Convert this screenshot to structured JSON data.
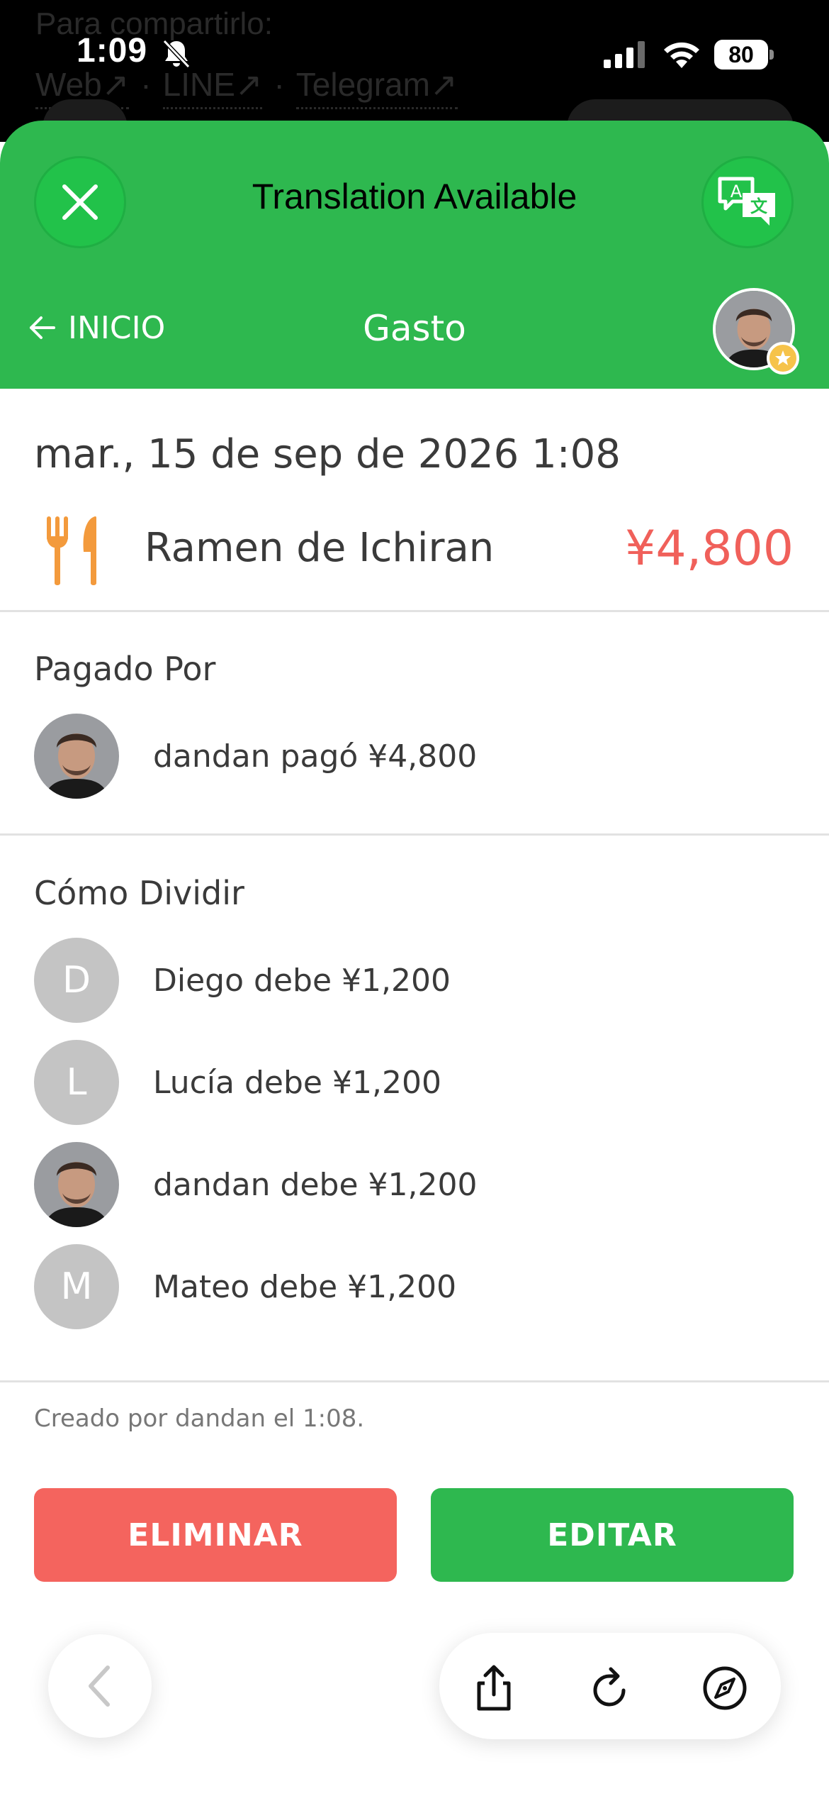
{
  "background_page": {
    "text": "Para compartirlo:",
    "links": [
      "Web↗",
      "LINE↗",
      "Telegram↗"
    ],
    "separator": "·"
  },
  "status_bar": {
    "time": "1:09",
    "battery": "80"
  },
  "banner": {
    "title": "Translation Available"
  },
  "header": {
    "back_label": "INICIO",
    "title": "Gasto"
  },
  "expense": {
    "date": "mar., 15 de sep de 2026 1:08",
    "name": "Ramen de Ichiran",
    "amount": "¥4,800",
    "category_icon": "fork-knife-icon"
  },
  "paid_by": {
    "title": "Pagado Por",
    "rows": [
      {
        "text": "dandan pagó ¥4,800",
        "avatar": "photo"
      }
    ]
  },
  "split": {
    "title": "Cómo Dividir",
    "rows": [
      {
        "initial": "D",
        "text": "Diego debe ¥1,200"
      },
      {
        "initial": "L",
        "text": "Lucía debe ¥1,200"
      },
      {
        "initial": "",
        "text": "dandan debe ¥1,200",
        "avatar": "photo"
      },
      {
        "initial": "M",
        "text": "Mateo debe ¥1,200"
      }
    ]
  },
  "footer": {
    "created": "Creado por dandan el 1:08."
  },
  "actions": {
    "delete_label": "ELIMINAR",
    "edit_label": "EDITAR"
  },
  "colors": {
    "brand_green": "#2eb84f",
    "amount_red": "#f0605a",
    "delete_red": "#f4645e",
    "icon_orange": "#f39a3c"
  }
}
